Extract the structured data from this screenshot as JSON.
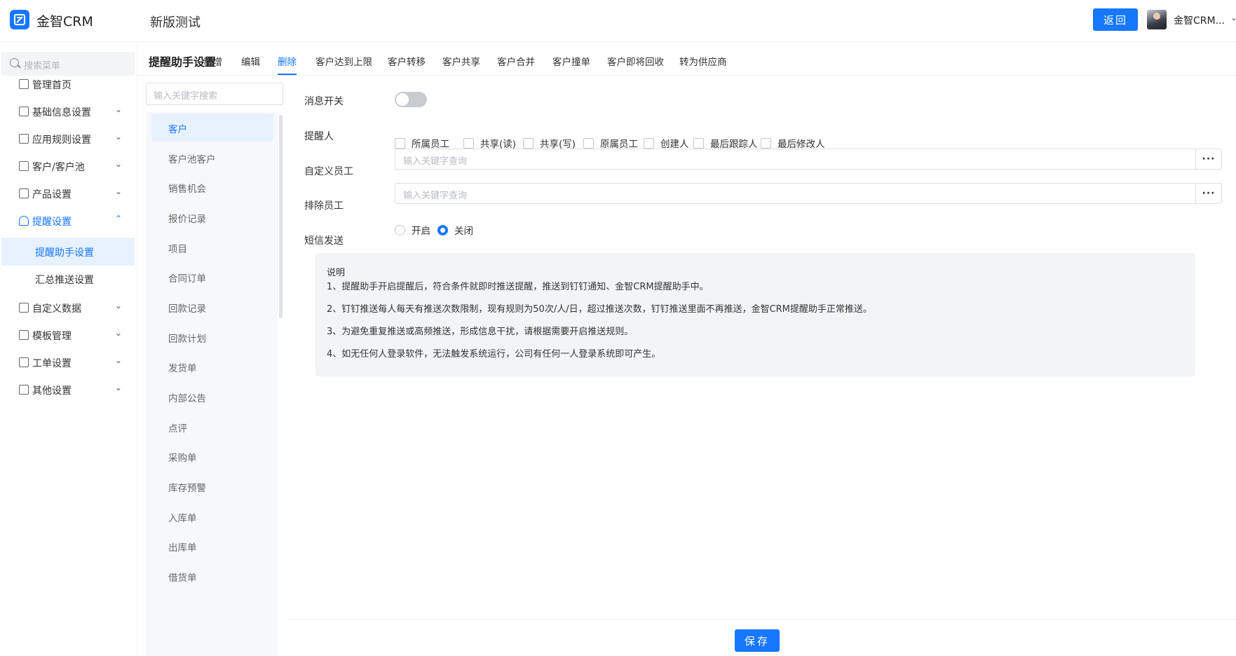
{
  "header": {
    "app_name": "金智CRM",
    "page_title": "新版测试",
    "back_label": "返回",
    "user_name": "金智CRM..."
  },
  "sidenav": {
    "search_placeholder": "搜索菜单",
    "items": [
      {
        "label": "管理首页",
        "icon": "home-icon"
      },
      {
        "label": "基础信息设置",
        "icon": "cube-icon"
      },
      {
        "label": "应用规则设置",
        "icon": "document-icon"
      },
      {
        "label": "客户/客户池",
        "icon": "users-icon"
      },
      {
        "label": "产品设置",
        "icon": "box-icon"
      },
      {
        "label": "提醒设置",
        "icon": "bell-icon"
      },
      {
        "label": "自定义数据",
        "icon": "tools-icon"
      },
      {
        "label": "模板管理",
        "icon": "template-icon"
      },
      {
        "label": "工单设置",
        "icon": "ticket-icon"
      },
      {
        "label": "其他设置",
        "icon": "grid-icon"
      }
    ],
    "sub_items": [
      "提醒助手设置",
      "汇总推送设置"
    ]
  },
  "tabs": {
    "title": "提醒助手设置",
    "items": [
      "新增",
      "编辑",
      "删除",
      "客户达到上限",
      "客户转移",
      "客户共享",
      "客户合并",
      "客户撞单",
      "客户即将回收",
      "转为供应商"
    ],
    "active": "删除"
  },
  "categories": {
    "search_placeholder": "输入关键字搜索",
    "items": [
      "客户",
      "客户池客户",
      "销售机会",
      "报价记录",
      "项目",
      "合同订单",
      "回款记录",
      "回款计划",
      "发货单",
      "内部公告",
      "点评",
      "采购单",
      "库存预警",
      "入库单",
      "出库单",
      "借货单"
    ],
    "active": "客户"
  },
  "form": {
    "switch_label": "消息开关",
    "switch_on": false,
    "reminder_label": "提醒人",
    "reminder_options": [
      "所属员工",
      "共享(读)",
      "共享(写)",
      "原属员工",
      "创建人",
      "最后跟踪人",
      "最后修改人"
    ],
    "custom_staff_label": "自定义员工",
    "custom_staff_placeholder": "输入关键字查询",
    "exclude_staff_label": "排除员工",
    "exclude_staff_placeholder": "输入关键字查询",
    "more_label": "···",
    "sms_label": "短信发送",
    "sms_options": [
      "开启",
      "关闭"
    ],
    "sms_selected": "关闭"
  },
  "note": {
    "title": "说明",
    "lines": [
      "1、提醒助手开启提醒后，符合条件就即时推送提醒，推送到钉钉通知、金智CRM提醒助手中。",
      "2、钉钉推送每人每天有推送次数限制，现有规则为50次/人/日，超过推送次数，钉钉推送里面不再推送，金智CRM提醒助手正常推送。",
      "3、为避免重复推送或高频推送，形成信息干扰，请根据需要开启推送规则。",
      "4、如无任何人登录软件，无法触发系统运行，公司有任何一人登录系统即可产生。"
    ]
  },
  "footer": {
    "save_label": "保存"
  },
  "colors": {
    "accent": "#1677ff",
    "active_bg": "#e8f1ff"
  }
}
